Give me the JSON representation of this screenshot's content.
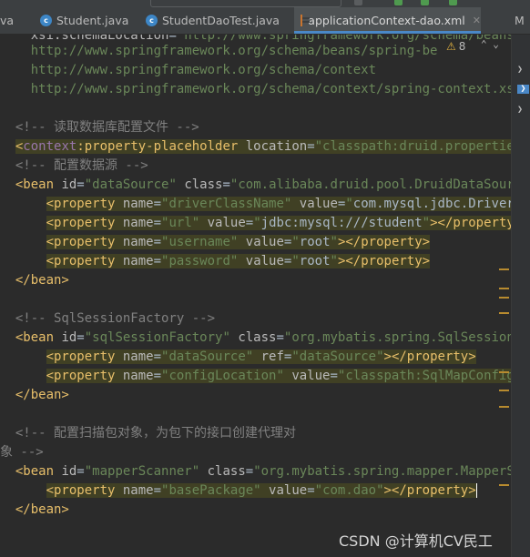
{
  "tabs": [
    {
      "label": "va",
      "type": "fragment"
    },
    {
      "label": "Student.java",
      "type": "class"
    },
    {
      "label": "StudentDaoTest.java",
      "type": "class"
    },
    {
      "label": "applicationContext-dao.xml",
      "type": "xml",
      "active": true
    },
    {
      "label": "M",
      "type": "fragment"
    }
  ],
  "editor": {
    "warnings_count": "8",
    "warning_icon": "warning-triangle-icon",
    "colors": {
      "background": "#2b2b2b",
      "tag": "#e8bf6a",
      "attribute": "#bababa",
      "string_value": "#6a8759",
      "comment": "#808080",
      "highlight": "#404024",
      "active_tab_underline": "#4a88c7"
    },
    "lines": [
      {
        "text": "xsi:schemaLocation=\"http://www.springframework.org/schema/beans"
      },
      {
        "text": "    http://www.springframework.org/schema/beans/spring-be"
      },
      {
        "text": "    http://www.springframework.org/schema/context"
      },
      {
        "text": "    http://www.springframework.org/schema/context/spring-context.xs"
      },
      {
        "text": ""
      },
      {
        "text": "<!-- 读取数据库配置文件 -->"
      },
      {
        "text": "<context:property-placeholder location=\"classpath:druid.properties\""
      },
      {
        "text": "<!-- 配置数据源 -->"
      },
      {
        "text": "<bean id=\"dataSource\" class=\"com.alibaba.druid.pool.DruidDataSource"
      },
      {
        "text": "    <property name=\"driverClassName\" value=\"com.mysql.jdbc.Driver\">"
      },
      {
        "text": "    <property name=\"url\" value=\"jdbc:mysql:///student\"></property>"
      },
      {
        "text": "    <property name=\"username\" value=\"root\"></property>"
      },
      {
        "text": "    <property name=\"password\" value=\"root\"></property>"
      },
      {
        "text": "</bean>"
      },
      {
        "text": ""
      },
      {
        "text": "<!-- SqlSessionFactory -->"
      },
      {
        "text": "<bean id=\"sqlSessionFactory\" class=\"org.mybatis.spring.SqlSessionFa"
      },
      {
        "text": "    <property name=\"dataSource\" ref=\"dataSource\"></property>"
      },
      {
        "text": "    <property name=\"configLocation\" value=\"classpath:SqlMapConfig.x"
      },
      {
        "text": "</bean>"
      },
      {
        "text": ""
      },
      {
        "text": "<!-- 配置扫描包对象，为包下的接口创建代理对"
      },
      {
        "text": "象 -->"
      },
      {
        "text": "<bean id=\"mapperScanner\" class=\"org.mybatis.spring.mapper.MapperSca"
      },
      {
        "text": "    <property name=\"basePackage\" value=\"com.dao\"></property>"
      },
      {
        "text": "</bean>"
      }
    ]
  },
  "watermark": "CSDN @计算机CV民工"
}
